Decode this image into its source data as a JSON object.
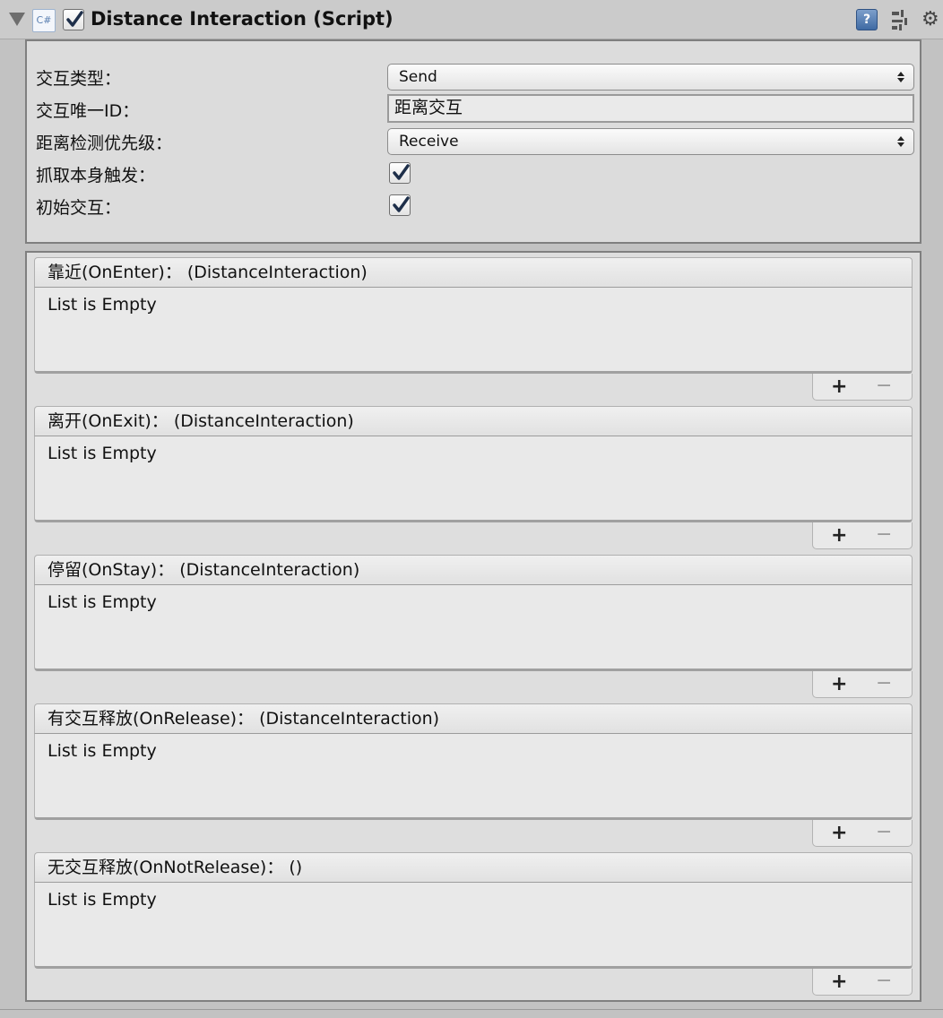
{
  "component": {
    "title": "Distance Interaction (Script)",
    "enabled": true,
    "icon_label": "C#",
    "help_icon_glyph": "?",
    "icons": [
      "foldout-arrow-icon",
      "csharp-script-icon",
      "help-icon",
      "presets-icon",
      "gear-icon"
    ]
  },
  "properties": {
    "interaction_type_label": "交互类型：",
    "interaction_type_value": "Send",
    "unique_id_label": "交互唯一ID：",
    "unique_id_value": "距离交互",
    "priority_label": "距离检测优先级：",
    "priority_value": "Receive",
    "grab_trigger_label": "抓取本身触发：",
    "grab_trigger_checked": true,
    "initial_interaction_label": "初始交互：",
    "initial_interaction_checked": true
  },
  "events": [
    {
      "header": "靠近(OnEnter)：  (DistanceInteraction)",
      "empty_text": "List is Empty",
      "add": "+",
      "remove": "−"
    },
    {
      "header": "离开(OnExit)：  (DistanceInteraction)",
      "empty_text": "List is Empty",
      "add": "+",
      "remove": "−"
    },
    {
      "header": "停留(OnStay)：  (DistanceInteraction)",
      "empty_text": "List is Empty",
      "add": "+",
      "remove": "−"
    },
    {
      "header": "有交互释放(OnRelease)：  (DistanceInteraction)",
      "empty_text": "List is Empty",
      "add": "+",
      "remove": "−"
    },
    {
      "header": "无交互释放(OnNotRelease)：  ()",
      "empty_text": "List is Empty",
      "add": "+",
      "remove": "−"
    }
  ],
  "colors": {
    "background": "#c2c2c2",
    "panel": "#dcdcdc",
    "checkbox_accent": "#1e2f4a",
    "help_icon": "#4a74ad"
  }
}
